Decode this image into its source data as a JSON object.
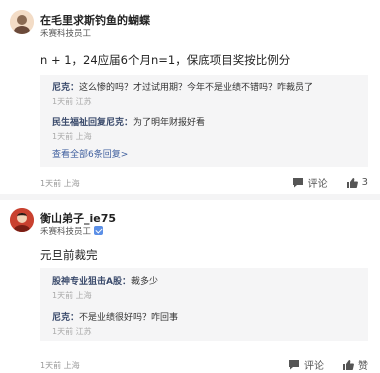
{
  "posts": [
    {
      "username": "在毛里求斯钓鱼的蝴蝶",
      "company": "禾赛科技员工",
      "verified": false,
      "content": "n + 1，24应届6个月n=1，保底项目奖按比例分",
      "replies": [
        {
          "author": "尼克：",
          "text": "这么惨的吗？才过试用期？今年不是业绩不错吗？咋裁员了",
          "meta": "1天前  江苏"
        },
        {
          "author": "民生福祉回复尼克：",
          "text": "为了明年财报好看",
          "meta": "1天前  上海"
        }
      ],
      "view_all": "查看全部6条回复>",
      "meta": "1天前  上海",
      "comment_label": "评论",
      "like_label": "3"
    },
    {
      "username": "衡山弟子_ie75",
      "company": "禾赛科技员工",
      "verified": true,
      "content": "元旦前裁完",
      "replies": [
        {
          "author": "股神专业狙击A股：",
          "text": "裁多少",
          "meta": "1天前  上海"
        },
        {
          "author": "尼克：",
          "text": "不是业绩很好吗？咋回事",
          "meta": "1天前  江苏"
        }
      ],
      "meta": "1天前  上海",
      "comment_label": "评论",
      "like_label": "赞"
    }
  ],
  "colors": {
    "avatar1": "#e8c8a8",
    "avatar2": "#c43a2a",
    "link": "#3f5f9e"
  },
  "icons": [
    "comment-icon",
    "thumbs-up-icon",
    "verified-icon"
  ]
}
